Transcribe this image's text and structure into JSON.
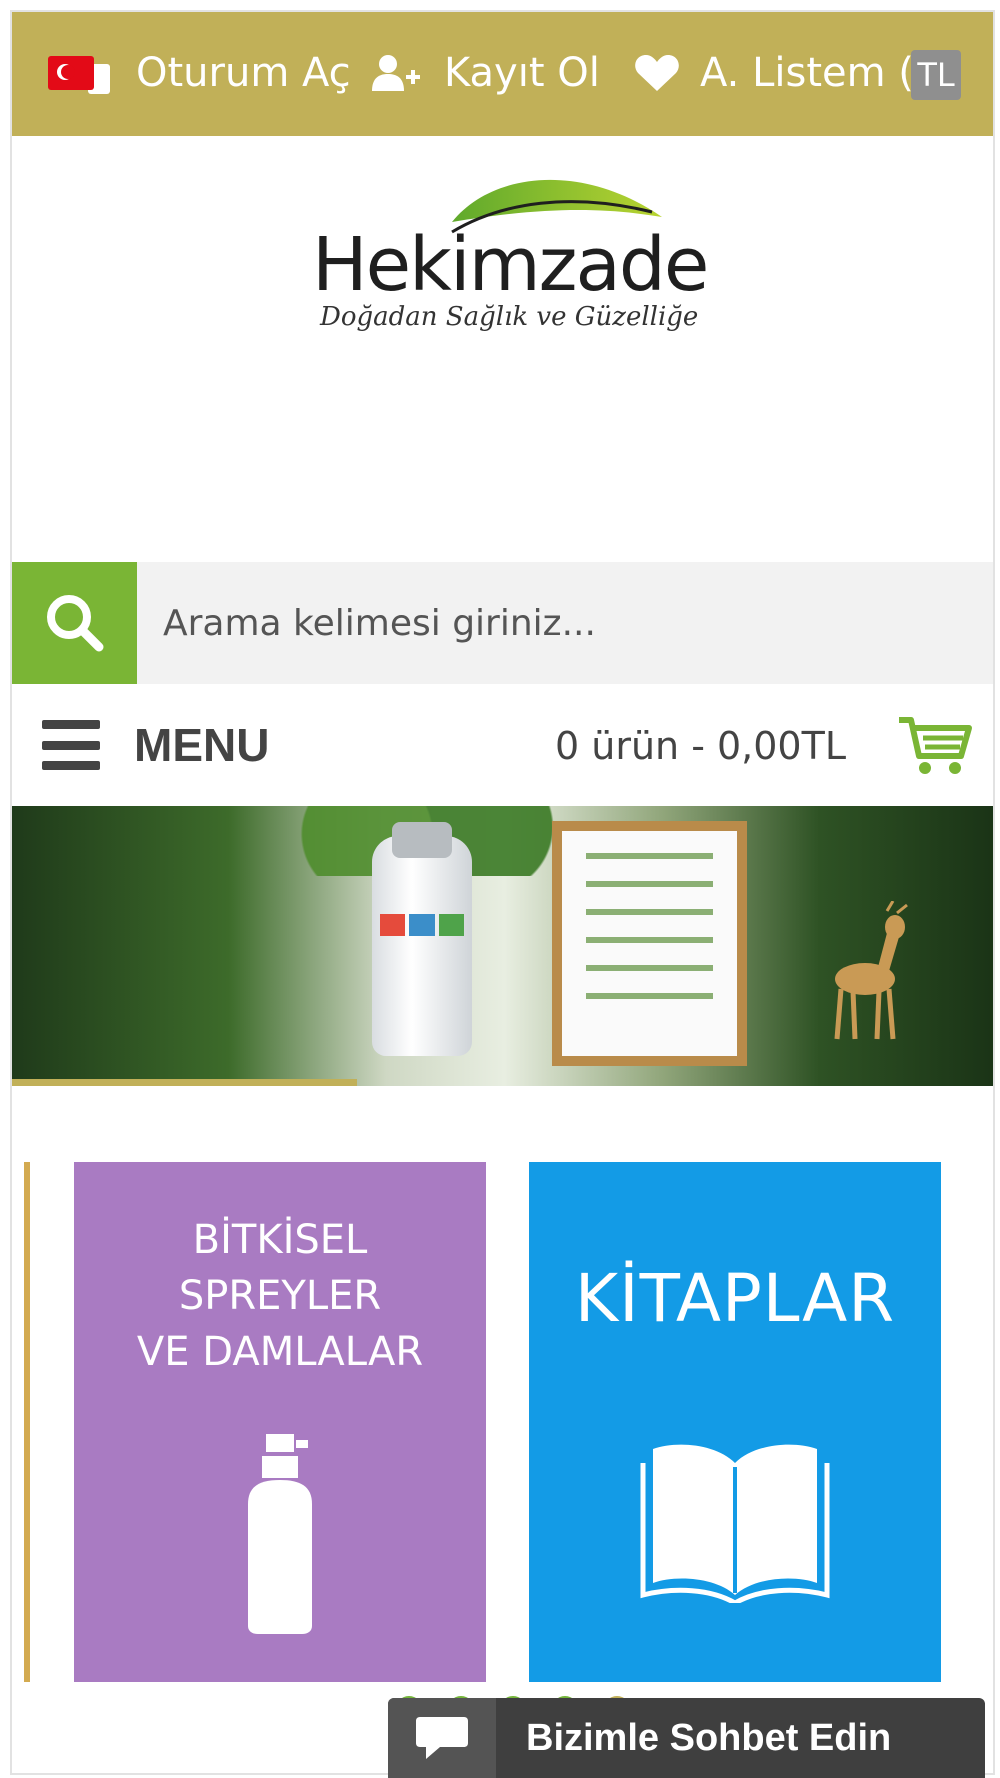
{
  "topbar": {
    "login_label": "Oturum Aç",
    "register_label": "Kayıt Ol",
    "wishlist_label": "A. Listem (0",
    "currency": "TL"
  },
  "logo": {
    "brand": "Hekimzade",
    "tagline": "Doğadan Sağlık ve Güzelliğe"
  },
  "search": {
    "placeholder": "Arama kelimesi giriniz..."
  },
  "menu": {
    "label": "MENU"
  },
  "cart": {
    "summary": "0 ürün - 0,00TL"
  },
  "banner": {
    "progress": 0.35
  },
  "categories": [
    {
      "title": "BİTKİSEL\nSPREYLER\nVE DAMLALAR",
      "icon": "spray-bottle-icon",
      "color": "#a97bc2"
    },
    {
      "title": "KİTAPLAR",
      "icon": "open-book-icon",
      "color": "#139be6"
    }
  ],
  "carousel": {
    "dot_count": 5,
    "active_index": 4
  },
  "chat": {
    "label": "Bizimle Sohbet Edin"
  },
  "colors": {
    "topbar": "#c1b058",
    "search_button": "#7ab535",
    "accent_gold": "#d3aa50"
  }
}
